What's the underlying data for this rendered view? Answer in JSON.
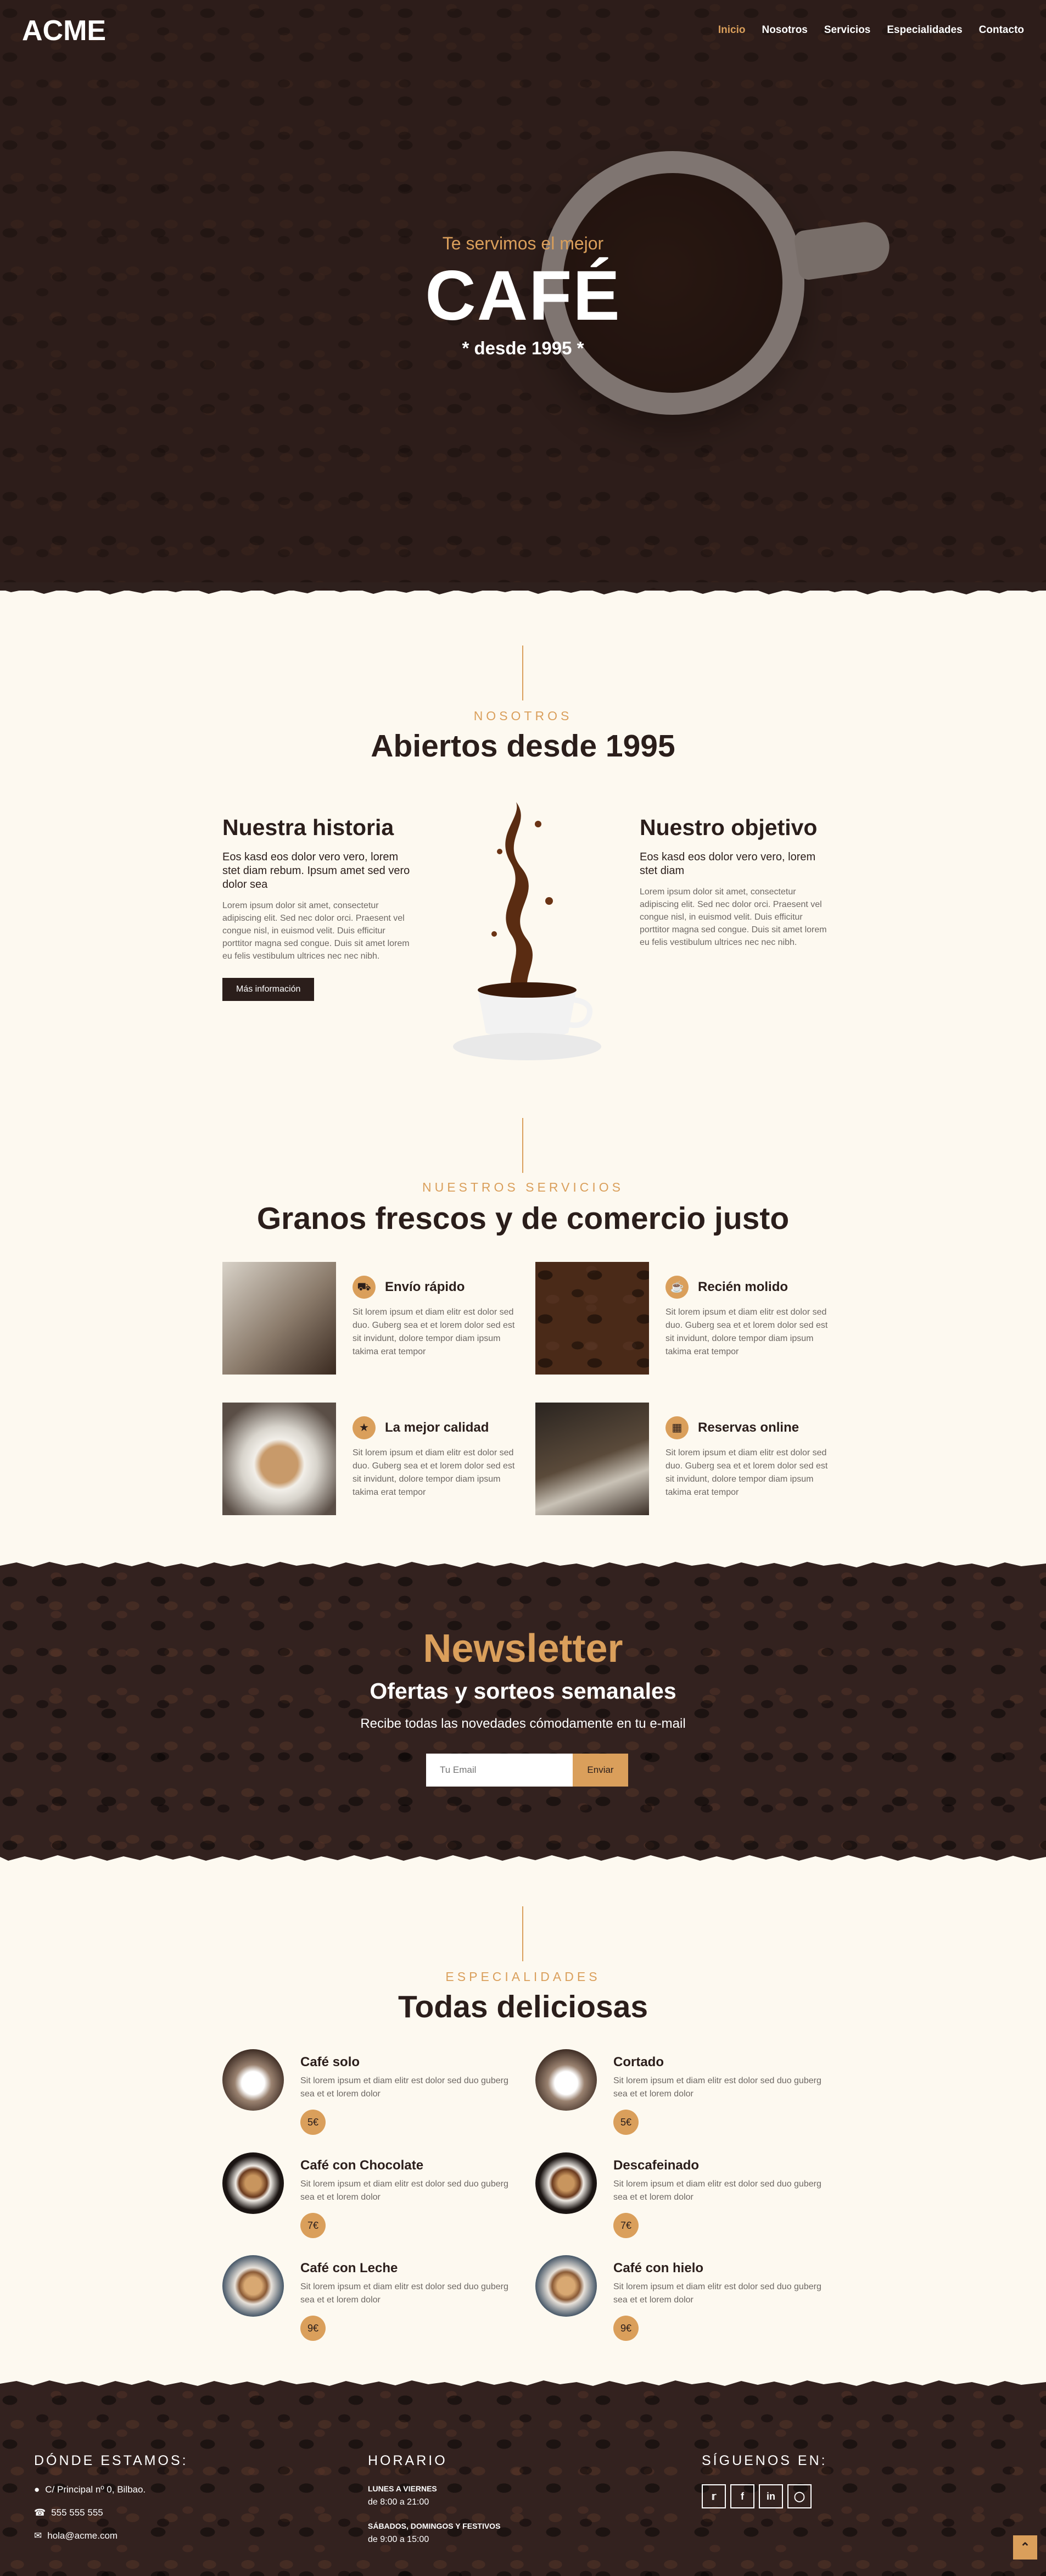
{
  "header": {
    "logo": "ACME",
    "nav": [
      "Inicio",
      "Nosotros",
      "Servicios",
      "Especialidades",
      "Contacto"
    ],
    "active_nav": "Inicio"
  },
  "hero": {
    "subtitle": "Te servimos el mejor",
    "title": "CAFÉ",
    "since": "* desde 1995 *"
  },
  "about": {
    "label": "NOSOTROS",
    "title": "Abiertos desde 1995",
    "history": {
      "heading": "Nuestra historia",
      "lead": "Eos kasd eos dolor vero vero, lorem stet diam rebum. Ipsum amet sed vero dolor sea",
      "body": "Lorem ipsum dolor sit amet, consectetur adipiscing elit. Sed nec dolor orci. Praesent vel congue nisl, in euismod velit. Duis efficitur porttitor magna sed congue. Duis sit amet lorem eu felis vestibulum ultrices nec nec nibh.",
      "button": "Más información"
    },
    "objective": {
      "heading": "Nuestro objetivo",
      "lead": "Eos kasd eos dolor vero vero, lorem stet diam",
      "body": "Lorem ipsum dolor sit amet, consectetur adipiscing elit. Sed nec dolor orci. Praesent vel congue nisl, in euismod velit. Duis efficitur porttitor magna sed congue. Duis sit amet lorem eu felis vestibulum ultrices nec nec nibh."
    }
  },
  "services": {
    "label": "NUESTROS SERVICIOS",
    "title": "Granos frescos y de comercio justo",
    "items": [
      {
        "title": "Envío rápido",
        "icon": "truck-icon",
        "text": "Sit lorem ipsum et diam elitr est dolor sed duo. Guberg sea et et lorem dolor sed est sit invidunt, dolore tempor diam ipsum takima erat tempor"
      },
      {
        "title": "Recién molido",
        "icon": "coffee-icon",
        "text": "Sit lorem ipsum et diam elitr est dolor sed duo. Guberg sea et et lorem dolor sed est sit invidunt, dolore tempor diam ipsum takima erat tempor"
      },
      {
        "title": "La mejor calidad",
        "icon": "award-icon",
        "text": "Sit lorem ipsum et diam elitr est dolor sed duo. Guberg sea et et lorem dolor sed est sit invidunt, dolore tempor diam ipsum takima erat tempor"
      },
      {
        "title": "Reservas online",
        "icon": "table-icon",
        "text": "Sit lorem ipsum et diam elitr est dolor sed duo. Guberg sea et et lorem dolor sed est sit invidunt, dolore tempor diam ipsum takima erat tempor"
      }
    ]
  },
  "newsletter": {
    "title": "Newsletter",
    "subtitle": "Ofertas y sorteos semanales",
    "description": "Recibe todas las novedades cómodamente en tu e-mail",
    "placeholder": "Tu Email",
    "button": "Enviar"
  },
  "specialties": {
    "label": "ESPECIALIDADES",
    "title": "Todas deliciosas",
    "items": [
      {
        "name": "Café solo",
        "text": "Sit lorem ipsum et diam elitr est dolor sed duo guberg sea et et lorem dolor",
        "price": "5€"
      },
      {
        "name": "Cortado",
        "text": "Sit lorem ipsum et diam elitr est dolor sed duo guberg sea et et lorem dolor",
        "price": "5€"
      },
      {
        "name": "Café con Chocolate",
        "text": "Sit lorem ipsum et diam elitr est dolor sed duo guberg sea et et lorem dolor",
        "price": "7€"
      },
      {
        "name": "Descafeinado",
        "text": "Sit lorem ipsum et diam elitr est dolor sed duo guberg sea et et lorem dolor",
        "price": "7€"
      },
      {
        "name": "Café con Leche",
        "text": "Sit lorem ipsum et diam elitr est dolor sed duo guberg sea et et lorem dolor",
        "price": "9€"
      },
      {
        "name": "Café con hielo",
        "text": "Sit lorem ipsum et diam elitr est dolor sed duo guberg sea et et lorem dolor",
        "price": "9€"
      }
    ]
  },
  "footer": {
    "location": {
      "heading": "DÓNDE ESTAMOS:",
      "address": "C/ Principal nº 0, Bilbao.",
      "phone": "555 555 555",
      "email": "hola@acme.com"
    },
    "hours": {
      "heading": "HORARIO",
      "weekdays_label": "LUNES A VIERNES",
      "weekdays_time": "de 8:00 a 21:00",
      "weekend_label": "SÁBADOS, DOMINGOS Y FESTIVOS",
      "weekend_time": "de 9:00 a 15:00"
    },
    "social": {
      "heading": "SÍGUENOS EN:",
      "networks": [
        "twitter-icon",
        "facebook-icon",
        "linkedin-icon",
        "instagram-icon"
      ]
    }
  },
  "colors": {
    "accent": "#da9f5b",
    "dark": "#2b1e1b",
    "cream": "#fdf9f0"
  }
}
